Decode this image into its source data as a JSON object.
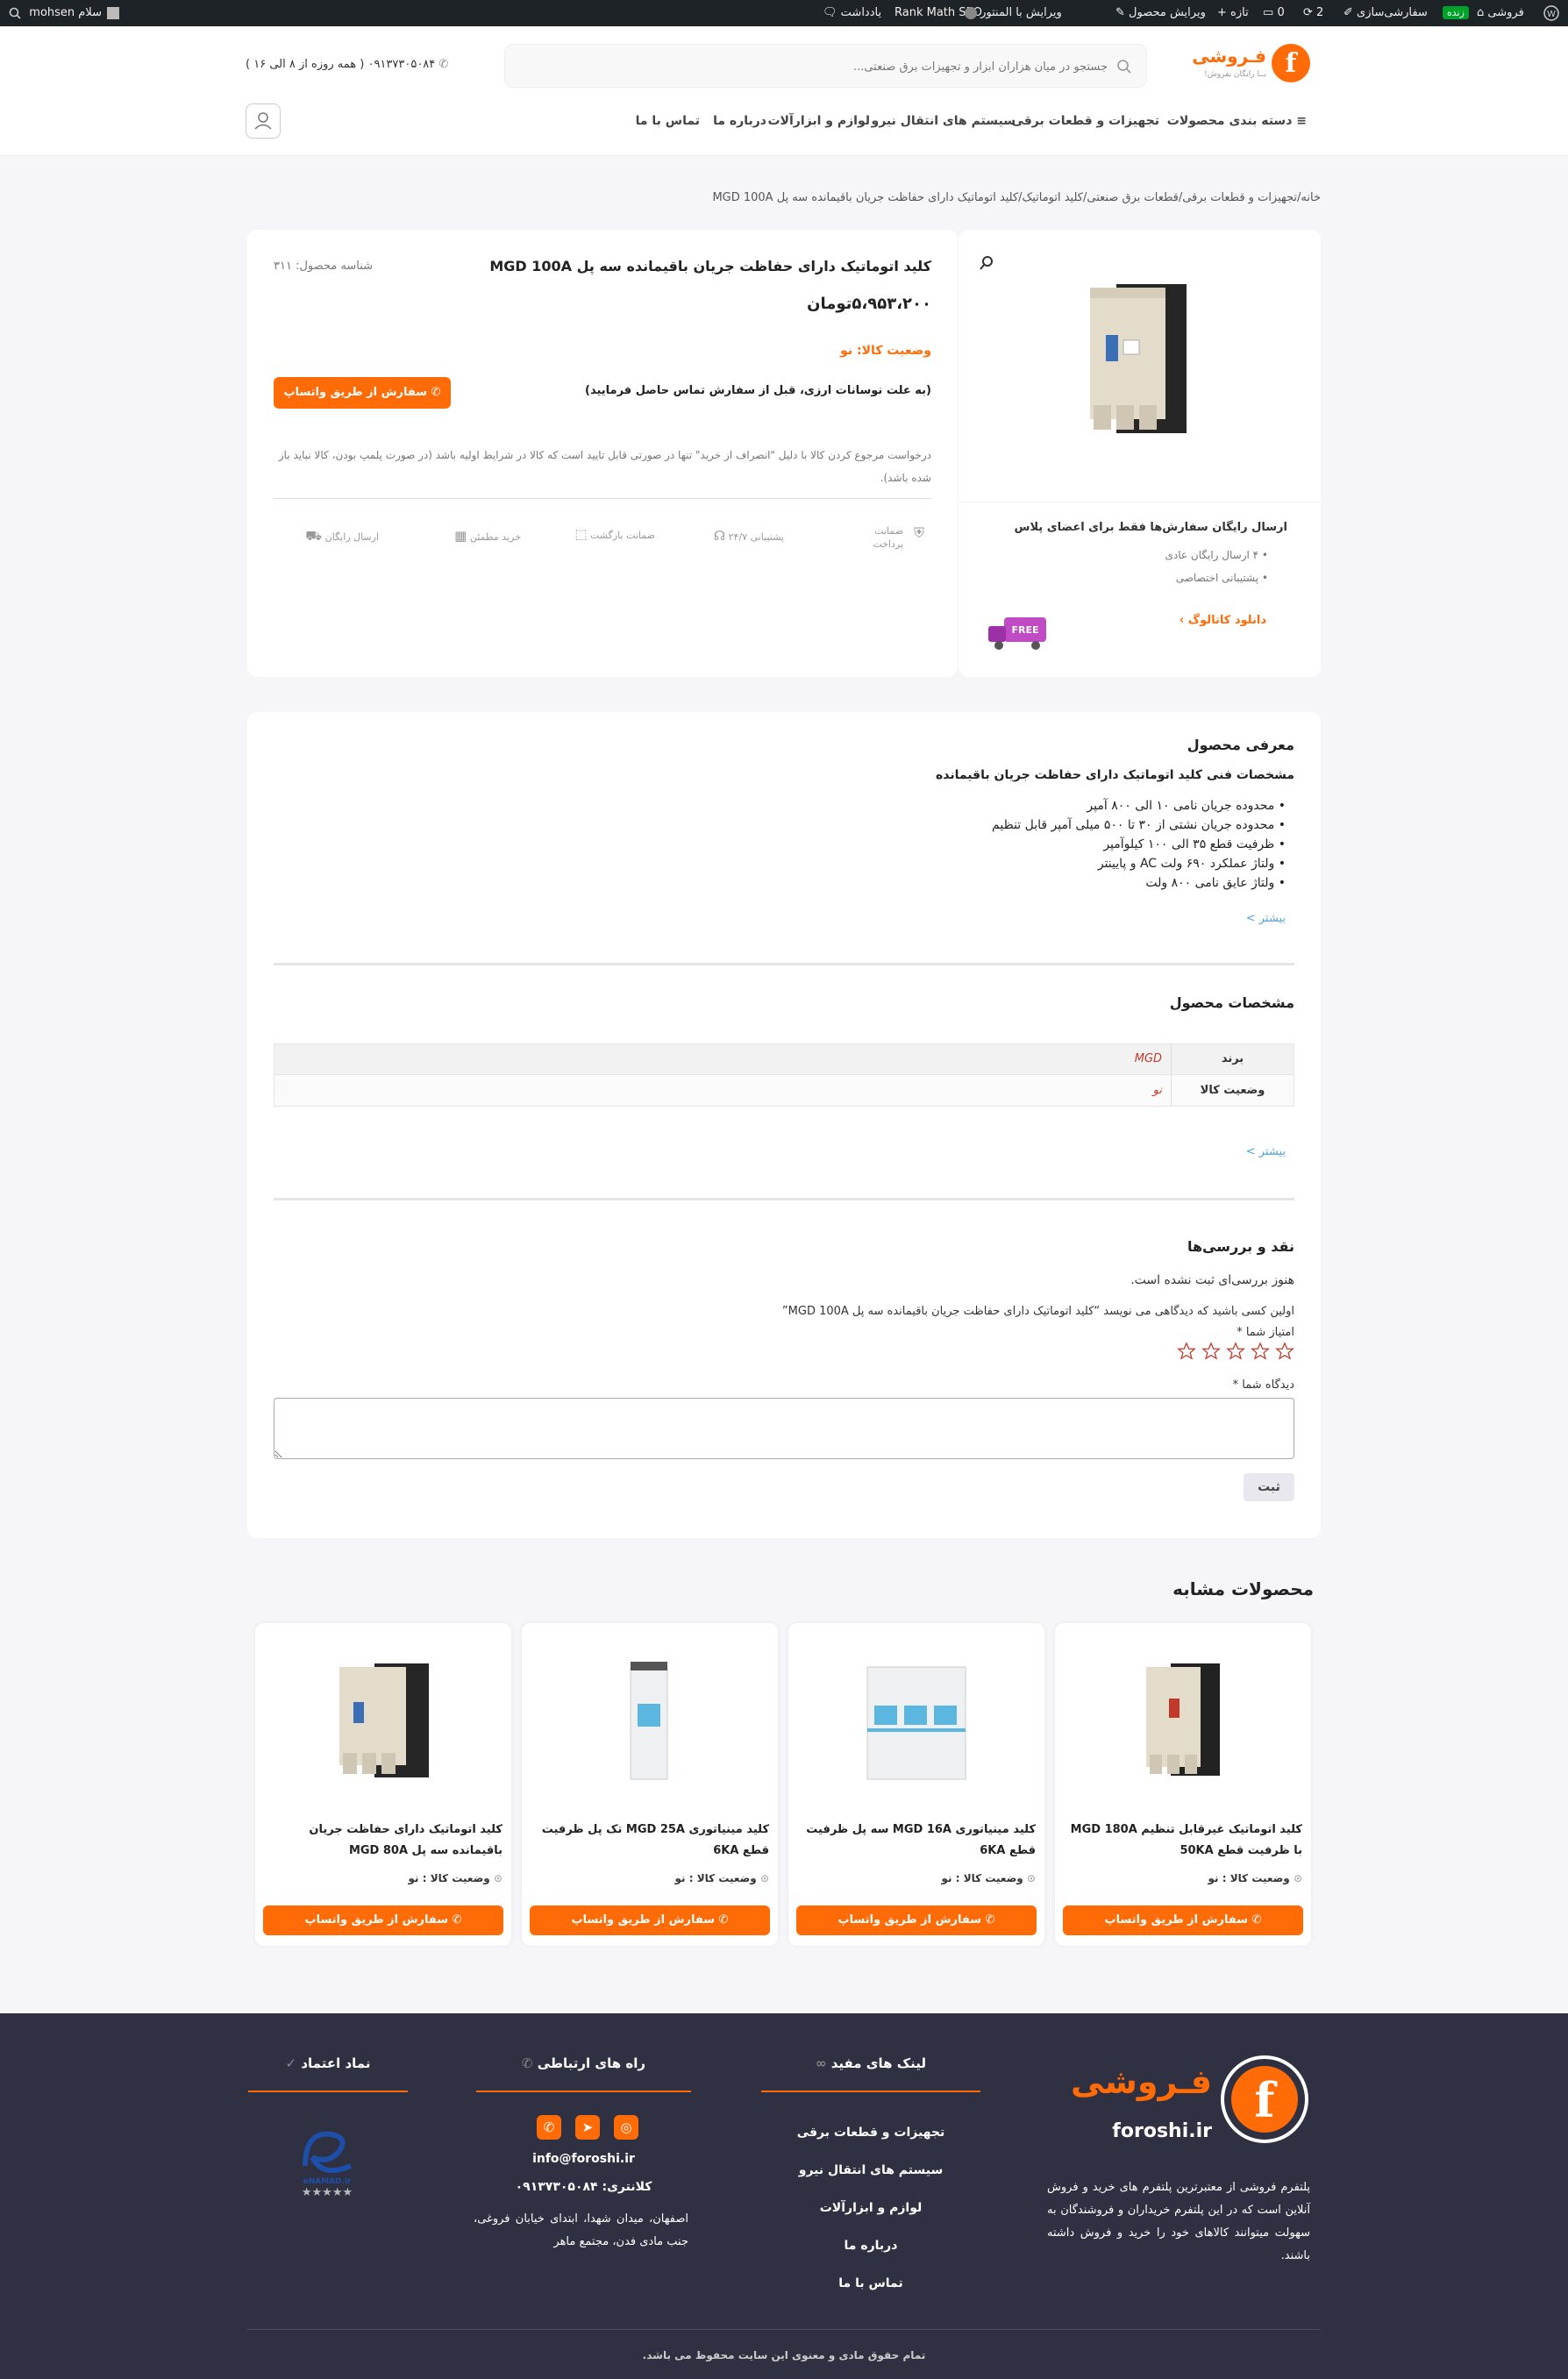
{
  "admin_bar": {
    "greeting": "سلام mohsen",
    "site": "فروشی",
    "live_badge": "زنده",
    "customize": "سفارشی‌سازی",
    "updates": "2",
    "comments": "0",
    "new": "تازه",
    "edit_product": "ویرایش محصول",
    "edit_elementor": "ویرایش با المنتور",
    "rank_math": "Rank Math SEO",
    "notes": "یادداشت"
  },
  "header": {
    "logo_text": "فـروشی",
    "logo_tagline": "بــا رایگان بفروش!",
    "search_placeholder": "جستجو در میان هزاران ابزار و تجهیزات برق صنعتی...",
    "phone": "۰۹۱۳۷۳۰۵۰۸۴ ( همه روزه از ۸ الی ۱۶ )",
    "nav": [
      "دسته بندی محصولات",
      "تجهیزات و قطعات برقی",
      "سیستم های انتقال نیرو",
      "لوازم و ابزارآلات",
      "درباره ما",
      "تماس با ما"
    ]
  },
  "breadcrumb": "خانه/تجهیزات و قطعات برقی/قطعات برق صنعتی/کلید اتوماتیک/کلید اتوماتیک دارای حفاظت جریان باقیمانده سه پل MGD 100A",
  "product": {
    "title": "کلید اتوماتیک دارای حفاظت جریان باقیمانده سه پل MGD 100A",
    "sku": "شناسه محصول: ۳۱۱",
    "price": "۵،۹۵۳،۲۰۰تومان",
    "status": "وضعیت کالا: نو",
    "notice": "(به علت نوسانات ارزی، قبل از سفارش تماس حاصل فرمایید)",
    "whatsapp_btn": "سفارش از طریق واتساپ",
    "return_policy": "درخواست مرجوع کردن کالا با دلیل \"انصراف از خرید\" تنها در صورتی قابل تایید است که کالا در شرایط اولیه باشد (در صورت پلمپ بودن، کالا نباید باز شده باشد).",
    "features": [
      "ضمانت پرداخت",
      "پشتیبانی ۲۴/۷",
      "ضمانت بازگشت",
      "خرید مطمئن",
      "ارسال رایگان"
    ],
    "shipping_title": "ارسال رایگان سفارش‌ها فقط برای اعضای پلاس",
    "shipping_items": [
      "۴ ارسال رایگان عادی",
      "پشتیبانی اختصاصی"
    ],
    "catalog_link": "دانلود کاتالوگ",
    "free_badge": "FREE"
  },
  "intro": {
    "heading": "معرفی محصول",
    "subheading": "مشخصات فنی کلید اتوماتیک دارای حفاظت جریان باقیمانده",
    "bullets": [
      "محدوده جریان نامی ۱۰ الی ۸۰۰ آمپر",
      "محدوده جریان نشتی از ۳۰ تا ۵۰۰ میلی آمپر قابل تنظیم",
      "ظرفیت قطع ۳۵ الی ۱۰۰ کیلوآمپر",
      "ولتاژ عملکرد ۶۹۰ ولت AC و پایینتر",
      "ولتاژ عایق نامی ۸۰۰ ولت"
    ],
    "more": "بیشتر >"
  },
  "specs": {
    "heading": "مشخصات محصول",
    "rows": [
      {
        "label": "برند",
        "value": "MGD"
      },
      {
        "label": "وضعیت کالا",
        "value": "نو"
      }
    ],
    "more": "بیشتر >"
  },
  "reviews": {
    "heading": "نقد و بررسی‌ها",
    "none": "هنوز بررسی‌ای ثبت نشده است.",
    "first": "اولین کسی باشید که دیدگاهی می نویسد “کلید اتوماتیک دارای حفاظت جریان باقیمانده سه پل MGD 100A”",
    "rating_label": "امتیاز شما *",
    "comment_label": "دیدگاه شما *",
    "submit": "ثبت"
  },
  "similar": {
    "heading": "محصولات مشابه",
    "items": [
      {
        "title": "کلید اتوماتیک غیرقابل تنظیم MGD 180A با ظرفیت قطع 50KA",
        "status": "وضعیت کالا : نو",
        "btn": "سفارش از طریق واتساپ"
      },
      {
        "title": "کلید مینیاتوری MGD 16A سه پل ظرفیت قطع 6KA",
        "status": "وضعیت کالا : نو",
        "btn": "سفارش از طریق واتساپ"
      },
      {
        "title": "کلید مینیاتوری MGD 25A تک پل ظرفیت قطع 6KA",
        "status": "وضعیت کالا : نو",
        "btn": "سفارش از طریق واتساپ"
      },
      {
        "title": "کلید اتوماتیک دارای حفاظت جریان باقیمانده سه پل MGD 80A",
        "status": "وضعیت کالا : نو",
        "btn": "سفارش از طریق واتساپ"
      }
    ]
  },
  "footer": {
    "logo_text": "فـروشی",
    "domain": "foroshi.ir",
    "about": "پلتفرم فروشی از معتبرترین پلتفرم های خرید و فروش آنلاین است که در این پلتفرم خریداران و فروشندگان به سهولت میتوانند کالاهای خود را خرید و فروش داشته باشند.",
    "links_title": "لینک های مفید",
    "links": [
      "تجهیزات و قطعات برقی",
      "سیستم های انتقال نیرو",
      "لوازم و ابزارآلات",
      "درباره ما",
      "تماس با ما"
    ],
    "contact_title": "راه های ارتباطی",
    "email": "info@foroshi.ir",
    "phone": "کلانتری: ۰۹۱۳۷۳۰۵۰۸۴",
    "address": "اصفهان، میدان شهدا، ابتدای خیابان فروغی، جنب مادی فدن، مجتمع ماهر",
    "trust_title": "نماد اعتماد",
    "enamad": "eNAMAD.ir",
    "copyright": "تمام حقوق مادی و معنوی این سایت محفوظ می باشد."
  },
  "colors": {
    "accent": "#ff6b06",
    "footer_bg": "#2f3042",
    "admin_bg": "#1d2327"
  }
}
